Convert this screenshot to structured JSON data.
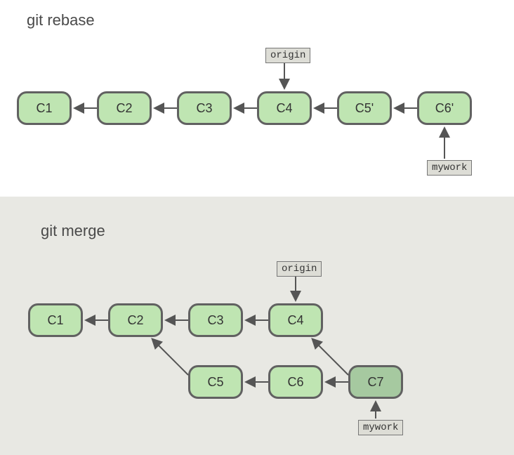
{
  "rebase": {
    "title": "git rebase",
    "commits": {
      "c1": "C1",
      "c2": "C2",
      "c3": "C3",
      "c4": "C4",
      "c5p": "C5'",
      "c6p": "C6'"
    },
    "tags": {
      "origin": "origin",
      "mywork": "mywork"
    }
  },
  "merge": {
    "title": "git merge",
    "commits": {
      "c1": "C1",
      "c2": "C2",
      "c3": "C3",
      "c4": "C4",
      "c5": "C5",
      "c6": "C6",
      "c7": "C7"
    },
    "tags": {
      "origin": "origin",
      "mywork": "mywork"
    }
  },
  "colors": {
    "commit_fill": "#bfe5b2",
    "commit_fill_dark": "#a6c9a0",
    "border": "#616161",
    "tag_bg": "#ddddd6",
    "panel_merge_bg": "#e8e8e3"
  }
}
